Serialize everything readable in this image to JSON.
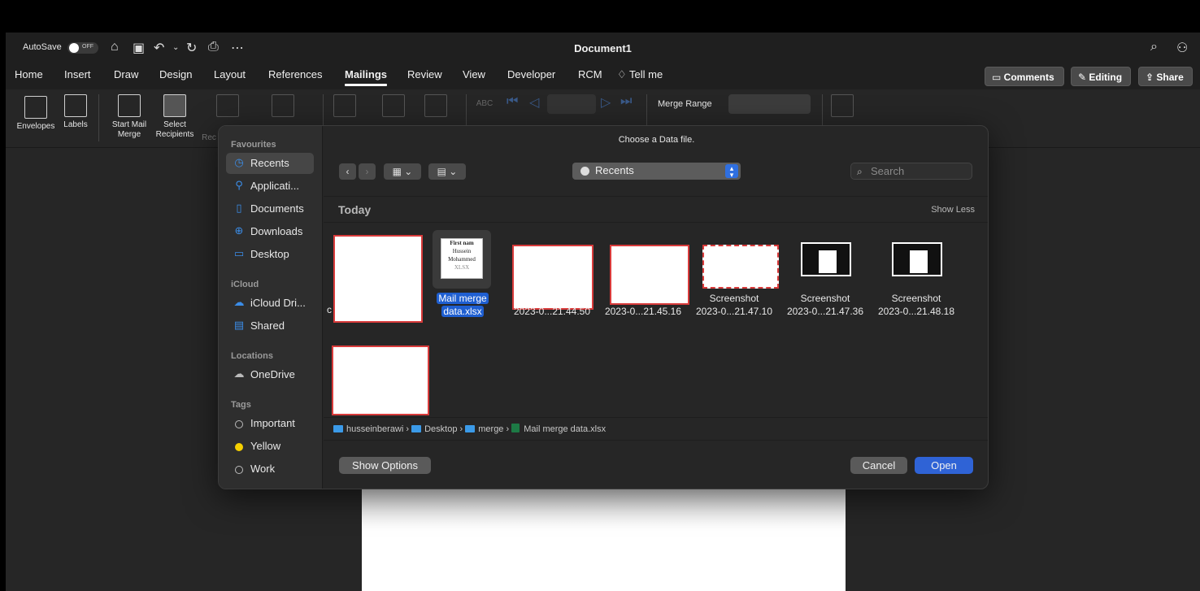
{
  "titlebar": {
    "autosave_label": "AutoSave",
    "toggle_state": "OFF",
    "document_title": "Document1"
  },
  "tabs": [
    "Home",
    "Insert",
    "Draw",
    "Design",
    "Layout",
    "References",
    "Mailings",
    "Review",
    "View",
    "Developer",
    "RCM",
    "Tell me"
  ],
  "active_tab": "Mailings",
  "actions": {
    "comments": "Comments",
    "editing": "Editing",
    "share": "Share"
  },
  "ribbon": {
    "envelopes": "Envelopes",
    "labels": "Labels",
    "start_mail_merge_1": "Start Mail",
    "start_mail_merge_2": "Merge",
    "select_recipients_1": "Select",
    "select_recipients_2": "Recipients",
    "rec_partial": "Rec",
    "preview_abc": "ABC",
    "merge_range": "Merge Range"
  },
  "dialog": {
    "title": "Choose a Data file.",
    "location": "Recents",
    "search_placeholder": "Search",
    "section": "Today",
    "show_less": "Show Less",
    "sidebar": {
      "favourites": "Favourites",
      "icloud": "iCloud",
      "locations": "Locations",
      "tags": "Tags",
      "items": {
        "recents": "Recents",
        "applications": "Applicati...",
        "documents": "Documents",
        "downloads": "Downloads",
        "desktop": "Desktop",
        "icloud_drive": "iCloud Dri...",
        "shared": "Shared",
        "onedrive": "OneDrive",
        "important": "Important",
        "yellow": "Yellow",
        "work": "Work"
      }
    },
    "files": {
      "file1_partial": "c",
      "xlsx_name_1": "Mail merge",
      "xlsx_name_2": "data.xlsx",
      "xlsx_preview_1": "First nam",
      "xlsx_preview_2": "Hussein",
      "xlsx_preview_3": "Mohammed",
      "xlsx_ext": "XLSX",
      "file3_name": "2023-0...21.44.50",
      "file4_name": "2023-0...21.45.16",
      "file5_name_1": "Screenshot",
      "file5_name_2": "2023-0...21.47.10",
      "file6_name_1": "Screenshot",
      "file6_name_2": "2023-0...21.47.36",
      "file7_name_1": "Screenshot",
      "file7_name_2": "2023-0...21.48.18"
    },
    "path": {
      "p1": "husseinberawi",
      "p2": "Desktop",
      "p3": "merge",
      "p4": "Mail merge data.xlsx"
    },
    "buttons": {
      "show_options": "Show Options",
      "cancel": "Cancel",
      "open": "Open"
    }
  },
  "colors": {
    "accent_blue": "#2f63d6",
    "redaction_border": "#d83b3b",
    "tag_yellow": "#f5d000"
  }
}
